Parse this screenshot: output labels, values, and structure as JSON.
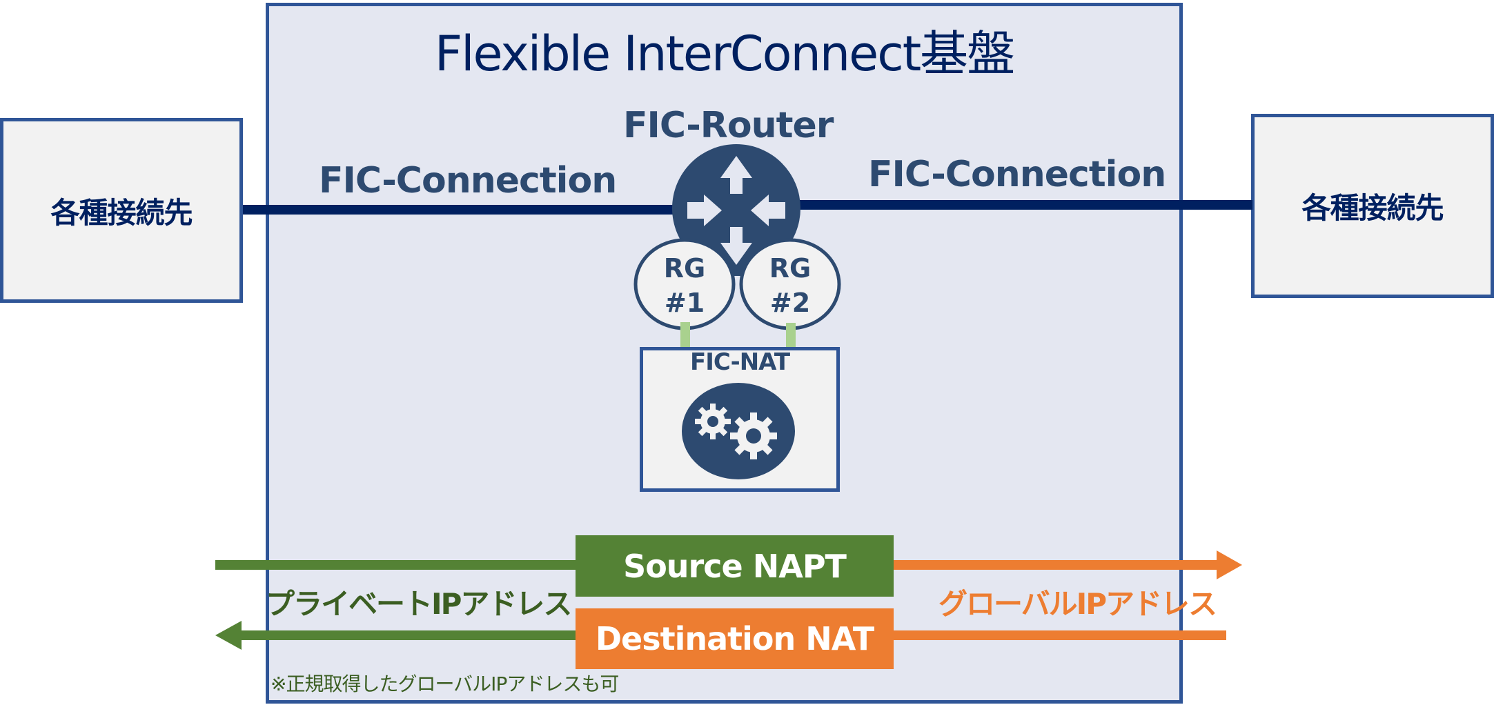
{
  "diagram": {
    "title": "Flexible InterConnect基盤",
    "endpoints": {
      "left": "各種接続先",
      "right": "各種接続先"
    },
    "connections": {
      "left": "FIC-Connection",
      "right": "FIC-Connection"
    },
    "router": {
      "label": "FIC-Router",
      "icon": "router-icon"
    },
    "route_groups": [
      {
        "line1": "RG",
        "line2": "#1"
      },
      {
        "line1": "RG",
        "line2": "#2"
      }
    ],
    "nat": {
      "label": "FIC-NAT",
      "icon": "gears-icon"
    },
    "nat_functions": {
      "source": "Source NAPT",
      "destination": "Destination NAT"
    },
    "address_labels": {
      "private": "プライベートIPアドレス",
      "global": "グローバルIPアドレス"
    },
    "footnote": "※正規取得したグローバルIPアドレスも可",
    "colors": {
      "navy": "#002060",
      "router_blue": "#2d4a70",
      "border_blue": "#2f5597",
      "platform_fill": "#e4e7f1",
      "green": "#548235",
      "orange": "#ed7d31",
      "light_green": "#a9d18e"
    }
  }
}
